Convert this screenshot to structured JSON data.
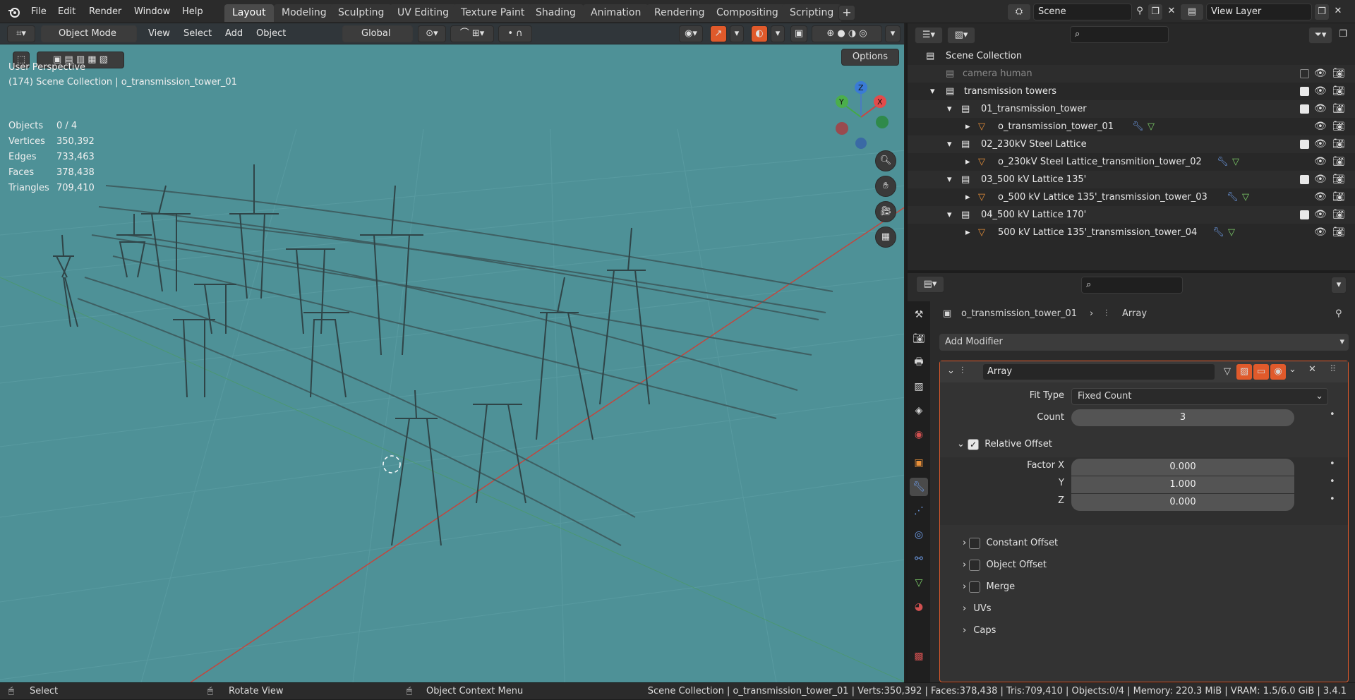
{
  "menu": [
    "File",
    "Edit",
    "Render",
    "Window",
    "Help"
  ],
  "workspaces": [
    "Layout",
    "Modeling",
    "Sculpting",
    "UV Editing",
    "Texture Paint",
    "Shading",
    "Animation",
    "Rendering",
    "Compositing",
    "Scripting"
  ],
  "active_workspace": "Layout",
  "scene": {
    "label": "Scene"
  },
  "view_layer": {
    "label": "View Layer"
  },
  "viewport": {
    "mode": "Object Mode",
    "menus": [
      "View",
      "Select",
      "Add",
      "Object"
    ],
    "orientation": "Global",
    "options_label": "Options",
    "perspective": "User Perspective",
    "collection_info": "(174) Scene Collection | o_transmission_tower_01",
    "stats": [
      {
        "k": "Objects",
        "v": "0 / 4"
      },
      {
        "k": "Vertices",
        "v": "350,392"
      },
      {
        "k": "Edges",
        "v": "733,463"
      },
      {
        "k": "Faces",
        "v": "378,438"
      },
      {
        "k": "Triangles",
        "v": "709,410"
      }
    ],
    "gizmo": {
      "x": "X",
      "y": "Y",
      "z": "Z"
    },
    "bg_color": "#4e9197"
  },
  "outliner": {
    "root": "Scene Collection",
    "rows": [
      {
        "label": "camera human",
        "level": 0,
        "dim": true
      },
      {
        "label": "transmission towers",
        "level": 0
      },
      {
        "label": "01_transmission_tower",
        "level": 1
      },
      {
        "label": "o_transmission_tower_01",
        "level": 2,
        "object": true
      },
      {
        "label": "02_230kV Steel Lattice",
        "level": 1
      },
      {
        "label": "o_230kV Steel Lattice_transmition_tower_02",
        "level": 2,
        "object": true
      },
      {
        "label": "03_500 kV Lattice 135'",
        "level": 1
      },
      {
        "label": "o_500 kV Lattice 135'_transmission_tower_03",
        "level": 2,
        "object": true
      },
      {
        "label": "04_500 kV Lattice 170'",
        "level": 1
      },
      {
        "label": "500 kV Lattice 135'_transmission_tower_04",
        "level": 2,
        "object": true
      }
    ]
  },
  "properties": {
    "breadcrumb_object": "o_transmission_tower_01",
    "breadcrumb_modifier": "Array",
    "add_modifier": "Add Modifier",
    "modifier_name": "Array",
    "fit_type_label": "Fit Type",
    "fit_type_value": "Fixed Count",
    "count_label": "Count",
    "count_value": "3",
    "relative_offset": "Relative Offset",
    "factor_x_label": "Factor X",
    "factor_x": "0.000",
    "y_label": "Y",
    "factor_y": "1.000",
    "z_label": "Z",
    "factor_z": "0.000",
    "constant_offset": "Constant Offset",
    "object_offset": "Object Offset",
    "merge": "Merge",
    "uvs": "UVs",
    "caps": "Caps",
    "accent": "#e05a2b"
  },
  "status": {
    "select": "Select",
    "rotate": "Rotate View",
    "context": "Object Context Menu",
    "info": "Scene Collection | o_transmission_tower_01 | Verts:350,392 | Faces:378,438 | Tris:709,410 | Objects:0/4 | Memory: 220.3 MiB | VRAM: 1.5/6.0 GiB | 3.4.1"
  }
}
